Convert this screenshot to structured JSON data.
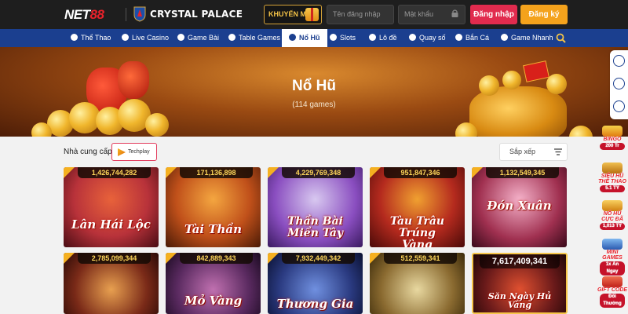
{
  "header": {
    "logo_net": "NET",
    "logo_num": "88",
    "partner_name": "CRYSTAL PALACE",
    "promo_label": "KHUYẾN MÃI",
    "username_placeholder": "Tên đăng nhập",
    "password_placeholder": "Mật khẩu",
    "login_label": "Đăng nhập",
    "register_label": "Đăng ký"
  },
  "nav": {
    "items": [
      {
        "label": "Thể Thao",
        "icon": "soccer-ball-icon"
      },
      {
        "label": "Live Casino",
        "icon": "casino-chip-icon"
      },
      {
        "label": "Game Bài",
        "icon": "playing-cards-icon"
      },
      {
        "label": "Table Games",
        "icon": "table-games-icon"
      },
      {
        "label": "Nổ Hũ",
        "icon": "slot-jar-icon",
        "active": true
      },
      {
        "label": "Slots",
        "icon": "slot-machine-icon"
      },
      {
        "label": "Lô đề",
        "icon": "lottery-ball-icon"
      },
      {
        "label": "Quay số",
        "icon": "lottery-wheel-icon"
      },
      {
        "label": "Bắn Cá",
        "icon": "fish-icon"
      },
      {
        "label": "Game Nhanh",
        "icon": "gamepad-icon"
      }
    ]
  },
  "banner": {
    "title": "Nổ Hũ",
    "subtitle": "(114 games)"
  },
  "filters": {
    "provider_label": "Nhà cung cấp",
    "provider_selected": "Techplay",
    "sort_label": "Sắp xếp"
  },
  "games": [
    {
      "jackpot": "1,426,744,282",
      "title": "Lân Hái Lộc",
      "bg": "#b8323a"
    },
    {
      "jackpot": "171,136,898",
      "title": "Tài Thần",
      "bg": "#c0501a"
    },
    {
      "jackpot": "4,229,769,348",
      "title": "Thần Bài Miền Tây",
      "bg": "#8a4ec0"
    },
    {
      "jackpot": "951,847,346",
      "title": "Tàu Trâu Trúng Vàng",
      "bg": "#b42a1e"
    },
    {
      "jackpot": "1,132,549,345",
      "title": "Đón Xuân",
      "bg": "#a03050"
    },
    {
      "jackpot": "2,785,099,344",
      "title": "",
      "bg": "#7a2a18"
    },
    {
      "jackpot": "842,889,343",
      "title": "Mỏ Vàng",
      "bg": "#5a2a60"
    },
    {
      "jackpot": "7,932,449,342",
      "title": "Thương Gia",
      "bg": "#2a3a80"
    },
    {
      "jackpot": "512,559,341",
      "title": "",
      "bg": "#8a6a30"
    },
    {
      "jackpot": "7,617,409,341",
      "title": "Săn Ngày Hủ Vàng",
      "bg": "#6a1a1a",
      "featured": true
    }
  ],
  "sidebar": {
    "contact_buttons": [
      "chat-icon",
      "telegram-icon",
      "help-icon"
    ],
    "promos": [
      {
        "title": "BINGO",
        "label": "200 Tr"
      },
      {
        "title": "SIÊU HŨ THỂ THAO",
        "label": "5.1 TỶ"
      },
      {
        "title": "NỔ HŨ CỰC ĐÃ",
        "label": "1,013 TỶ"
      },
      {
        "title": "MINI GAMES",
        "label": "1x Ăn Ngay"
      },
      {
        "title": "GIFT CODE",
        "label": "Đổi Thưởng"
      }
    ]
  },
  "colors": {
    "nav_bg": "#1b3f8f",
    "login": "#e12b4e",
    "register": "#f4a21c",
    "jackpot_text": "#ffd75a"
  }
}
